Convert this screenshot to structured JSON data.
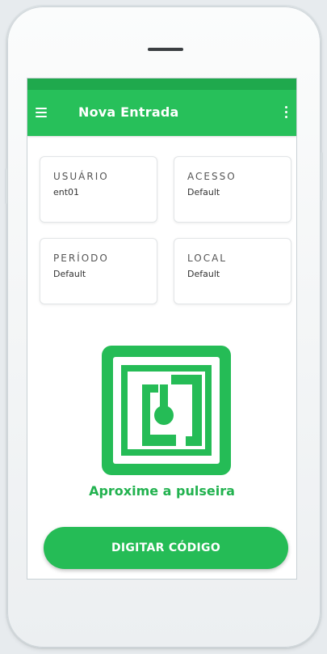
{
  "app_bar": {
    "title": "Nova Entrada",
    "menu_icon": "hamburger-menu-icon",
    "more_icon": "more-vertical-icon",
    "color": "#27c05a"
  },
  "cards": [
    {
      "label": "USUÁRIO",
      "value": "ent01"
    },
    {
      "label": "ACESSO",
      "value": "Default"
    },
    {
      "label": "PERÍODO",
      "value": "Default"
    },
    {
      "label": "LOCAL",
      "value": "Default"
    }
  ],
  "nfc": {
    "icon": "nfc-icon",
    "prompt": "Aproxime a pulseira",
    "color": "#25bc56"
  },
  "actions": {
    "type_code_label": "DIGITAR CÓDIGO"
  }
}
